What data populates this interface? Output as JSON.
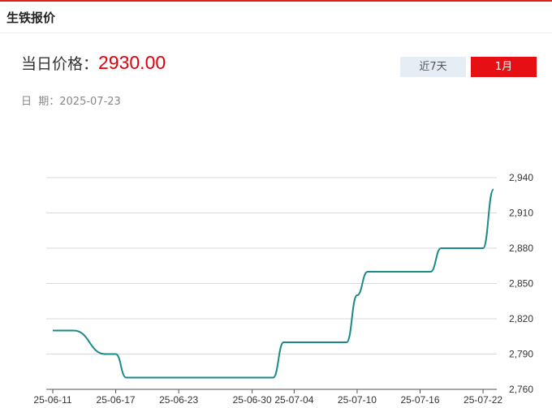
{
  "panel": {
    "title": "生铁报价"
  },
  "price": {
    "label": "当日价格：",
    "value": "2930.00"
  },
  "date": {
    "label": "日  期：",
    "value": "2025-07-23"
  },
  "range_buttons": {
    "week": "近7天",
    "month": "1月",
    "active": "month"
  },
  "colors": {
    "line": "#1a8a8a",
    "accent": "#e60f14",
    "grid": "#d9d9d9"
  },
  "chart_data": {
    "type": "line",
    "title": "",
    "xlabel": "",
    "ylabel": "",
    "ylim": [
      2760,
      2940
    ],
    "yticks": [
      2760,
      2790,
      2820,
      2850,
      2880,
      2910,
      2940
    ],
    "ytick_labels": [
      "2,760",
      "2,790",
      "2,820",
      "2,850",
      "2,880",
      "2,910",
      "2,940"
    ],
    "x_tick_labels": [
      "25-06-11",
      "25-06-17",
      "25-06-23",
      "25-06-30",
      "25-07-04",
      "25-07-10",
      "25-07-16",
      "25-07-22"
    ],
    "x": [
      "2025-06-11",
      "2025-06-12",
      "2025-06-13",
      "2025-06-16",
      "2025-06-17",
      "2025-06-18",
      "2025-06-19",
      "2025-06-20",
      "2025-06-23",
      "2025-06-24",
      "2025-06-25",
      "2025-06-26",
      "2025-06-27",
      "2025-06-30",
      "2025-07-01",
      "2025-07-02",
      "2025-07-03",
      "2025-07-04",
      "2025-07-07",
      "2025-07-08",
      "2025-07-09",
      "2025-07-10",
      "2025-07-11",
      "2025-07-14",
      "2025-07-15",
      "2025-07-16",
      "2025-07-17",
      "2025-07-18",
      "2025-07-21",
      "2025-07-22",
      "2025-07-23"
    ],
    "series": [
      {
        "values": [
          2810,
          2810,
          2810,
          2790,
          2790,
          2770,
          2770,
          2770,
          2770,
          2770,
          2770,
          2770,
          2770,
          2770,
          2770,
          2770,
          2800,
          2800,
          2800,
          2800,
          2800,
          2840,
          2860,
          2860,
          2860,
          2860,
          2860,
          2880,
          2880,
          2880,
          2930
        ]
      }
    ],
    "grid": true,
    "legend": "none"
  }
}
